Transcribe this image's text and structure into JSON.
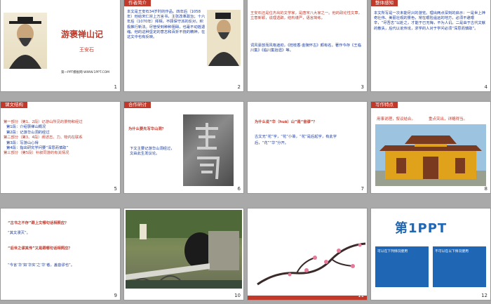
{
  "slides": [
    {
      "num": "1",
      "title": "游褒禅山记",
      "author": "王安石",
      "footer": "第一PPT模板网-WWW.1PPT.COM"
    },
    {
      "num": "2",
      "header": "作者简介",
      "text": "本文是王安石34岁时的作品。四年后（1058年）他给宋仁宗上万言书，主张改革政治；十六年后（1070年）拜相，不顾保守派的反对，积极推行新法。尽管受到种种阻碍，也毫不动摇退缩。他的这种坚定的意志和百折不挠的精神，在这文中也有反映。"
    },
    {
      "num": "3",
      "text1": "王安石还是位杰出的文学家，是唐宋八大家之一。他的政论性文章，立意新颖，说理透辟，结构谨严，语言简练。",
      "text2": "词风豪放而风格遒劲，《桂枝香·金陵怀古》颇有名。著作今存《王临川集》《临川集拾遗》等。"
    },
    {
      "num": "4",
      "header": "整体感知",
      "text": "本文所写是一次未能尽兴的游览。理出两点深刻的启示：一是世上神奇壮伟、美丽壮观的景色，常在艰险遥远的地方，必须不避艰辛，“尽吾志”以赴之，才能于已无悔，不为人讥。二是由于古代文献的散失，后代以讹传讹，求学的人对于学问必须“深思而慎取”。"
    },
    {
      "num": "5",
      "header": "课文结构",
      "items": [
        "第一部分（第1、2段）记游山所见的景物和经过",
        "第1段：介绍褒禅山概况",
        "第2段：记游华山洞的经过",
        "第二部分（第3、4段）阐述志、力、物内在联系",
        "第3段：写游山心得",
        "第4段：指出研究学问要“深思而慎取”",
        "第三部分（第5段）补叙同游的有关情况"
      ]
    },
    {
      "num": "6",
      "header": "合作研讨",
      "question": "为什么要先写华山洞？",
      "answer": "下文主要记游华山洞经过，文由此生发议论。"
    },
    {
      "num": "7",
      "question": "为什么说“华（huā）山”是“音谬”？",
      "answer": "古文无“花”字，“花”小篆，“花”是后起字，有此字后，“花”“华”分开。"
    },
    {
      "num": "8",
      "header": "写作特点",
      "tags": [
        "用事说理，叙议结合。",
        "重点突出，详略得当。"
      ]
    },
    {
      "num": "9",
      "q1": "“古书之不存”跟上文哪句话相照应？",
      "a1": "“其文漫灭”。",
      "q2": "“后世之谬其传”又是跟哪句话相照应？",
      "a2": "“今言‘华’如‘华实’之‘华’者，盖音谬也”。"
    },
    {
      "num": "10"
    },
    {
      "num": "11"
    },
    {
      "num": "12",
      "logo": "第1PPT",
      "ad1": "可以在下列情况使用",
      "ad2": "不可以在以下情况使用"
    }
  ],
  "colors": {
    "accent": "#c0392b",
    "blue": "#1a3a9a",
    "gold": "#e0a21a"
  }
}
